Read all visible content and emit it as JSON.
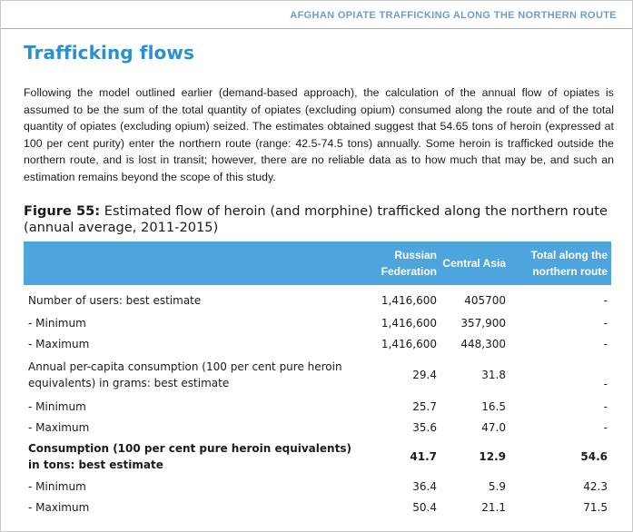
{
  "running_head": "AFGHAN OPIATE TRAFFICKING ALONG THE NORTHERN ROUTE",
  "section_title": "Trafficking flows",
  "body_text": "Following the model outlined earlier (demand-based approach), the calculation of the annual flow of opiates is assumed to be the sum of the total quantity of opiates (excluding opium) consumed along the route and of the total quantity of opiates (excluding opium) seized. The estimates obtained suggest that 54.65 tons of heroin (expressed at 100 per cent purity) enter the northern route (range: 42.5-74.5 tons) annually. Some heroin is trafficked outside the northern route, and is lost in transit; however, there are no reliable data as to how much that may be, and such an estimation remains beyond the scope of this study.",
  "figure": {
    "number": "Figure 55:",
    "title": "Estimated flow of heroin (and morphine) trafficked along the northern route (annual average, 2011-2015)"
  },
  "table": {
    "headers": [
      "",
      "Russian Federation",
      "Central Asia",
      "Total along the northern route"
    ],
    "rows": [
      {
        "label": "Number of users: best estimate",
        "russia": "1,416,600",
        "central_asia": "405700",
        "total": "-"
      },
      {
        "label": "- Minimum",
        "russia": "1,416,600",
        "central_asia": "357,900",
        "total": "-"
      },
      {
        "label": "- Maximum",
        "russia": "1,416,600",
        "central_asia": "448,300",
        "total": "-"
      },
      {
        "label": "Annual per-capita consumption (100 per cent pure heroin equivalents) in grams: best estimate",
        "russia": "29.4",
        "central_asia": "31.8",
        "total": "-"
      },
      {
        "label": "- Minimum",
        "russia": "25.7",
        "central_asia": "16.5",
        "total": "-"
      },
      {
        "label": "- Maximum",
        "russia": "35.6",
        "central_asia": "47.0",
        "total": "-"
      },
      {
        "label": "Consumption (100 per cent pure heroin equivalents) in tons: best estimate",
        "russia": "41.7",
        "central_asia": "12.9",
        "total": "54.6"
      },
      {
        "label": "- Minimum",
        "russia": "36.4",
        "central_asia": "5.9",
        "total": "42.3"
      },
      {
        "label": "- Maximum",
        "russia": "50.4",
        "central_asia": "21.1",
        "total": "71.5"
      }
    ]
  },
  "colors": {
    "accent_blue": "#2b8fd0",
    "table_header_bg": "#4ea5dd",
    "running_head": "#6d9ec8"
  }
}
